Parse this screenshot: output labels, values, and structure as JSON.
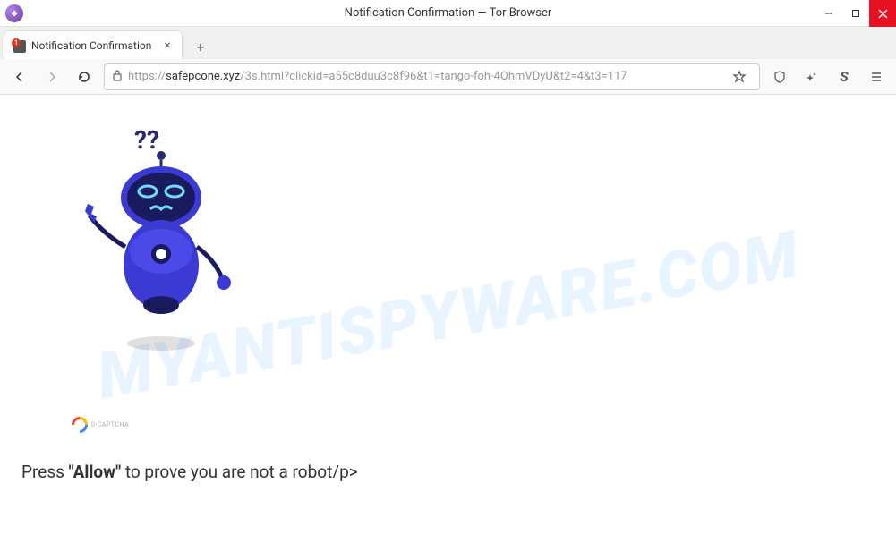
{
  "window": {
    "title": "Notification Confirmation — Tor Browser"
  },
  "tab": {
    "title": "Notification Confirmation",
    "badge": "1"
  },
  "url": {
    "protocol": "https://",
    "domain": "safepcone.xyz",
    "path": "/3s.html?clickid=a55c8duu3c8f96&t1=tango-foh-4OhmVDyU&t2=4&t3=117"
  },
  "captcha": {
    "label": "0-CAPTCHA"
  },
  "page": {
    "press": "Press ",
    "allow": "\"Allow\"",
    "prove": " to prove you are not a robot/p>"
  },
  "watermark": "MYANTISPYWARE.COM"
}
